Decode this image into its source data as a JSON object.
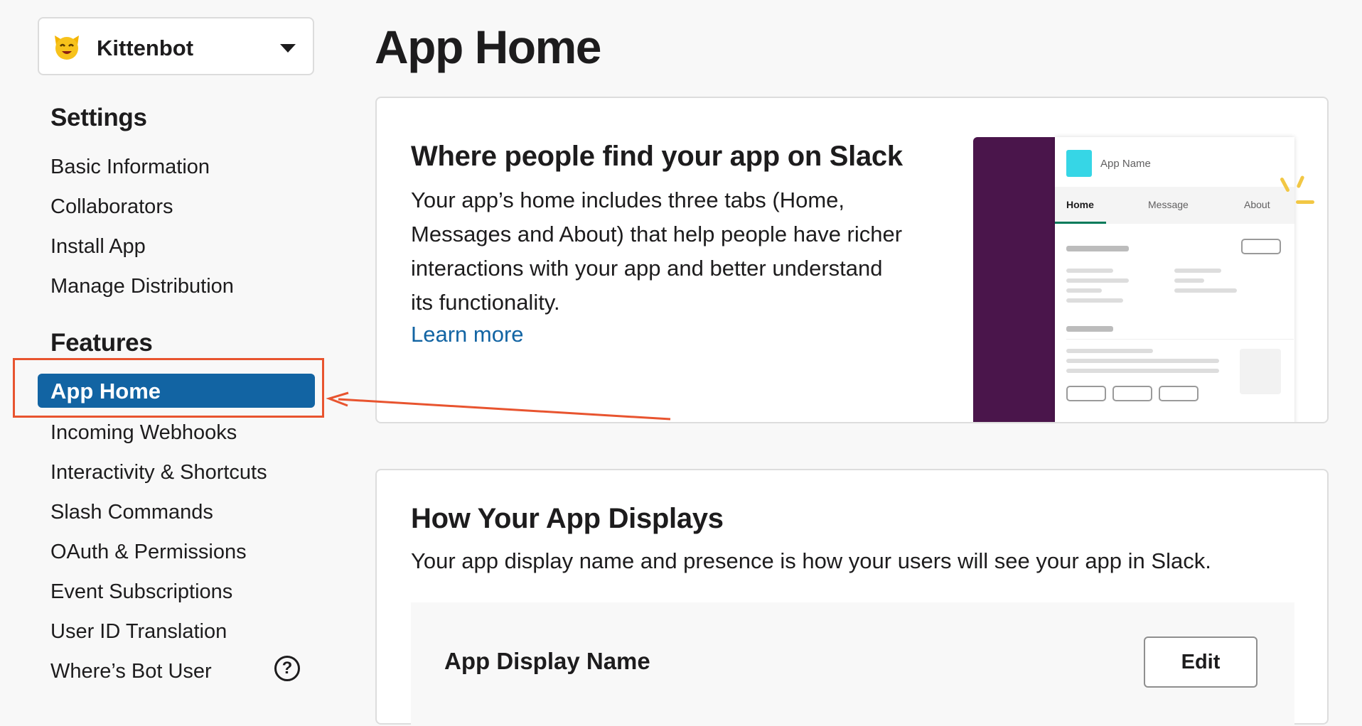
{
  "sidebar": {
    "app_name": "Kittenbot",
    "app_icon": "cat-face-icon",
    "settings_heading": "Settings",
    "settings_items": [
      "Basic Information",
      "Collaborators",
      "Install App",
      "Manage Distribution"
    ],
    "features_heading": "Features",
    "active_item": "App Home",
    "feature_items": [
      "Incoming Webhooks",
      "Interactivity & Shortcuts",
      "Slash Commands",
      "OAuth & Permissions",
      "Event Subscriptions",
      "User ID Translation",
      "Where’s Bot User"
    ],
    "help_glyph": "?"
  },
  "main": {
    "title": "App Home",
    "intro_card": {
      "title": "Where people find your app on Slack",
      "description_lines": [
        "Your app’s home includes three tabs (Home,",
        "Messages and About) that help people have richer",
        "interactions with your app and better understand",
        "its functionality."
      ],
      "learn_more": "Learn more",
      "preview": {
        "app_name": "App Name",
        "tabs": [
          "Home",
          "Message",
          "About"
        ]
      }
    },
    "display_card": {
      "title": "How Your App Displays",
      "description": "Your app display name and presence is how your users will see your app in Slack.",
      "display_name_label": "App Display Name",
      "edit_label": "Edit"
    }
  },
  "colors": {
    "accent": "#1264a3",
    "annotation": "#e8542f",
    "preview_rail": "#4a154b",
    "preview_icon": "#36d6e6",
    "tab_underline": "#007a5a"
  }
}
